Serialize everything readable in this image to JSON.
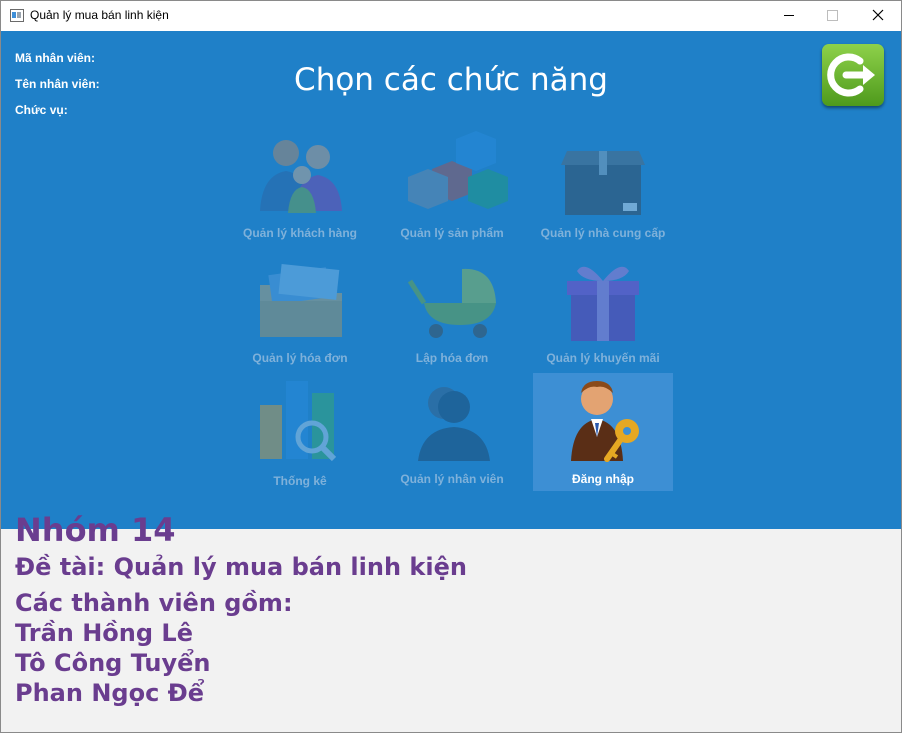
{
  "window": {
    "title": "Quản lý mua bán linh kiện"
  },
  "employee": {
    "id_label": "Mã nhân viên:",
    "name_label": "Tên nhân viên:",
    "role_label": "Chức vụ:"
  },
  "main": {
    "heading": "Chọn các chức năng"
  },
  "functions": [
    {
      "label": "Quản lý khách hàng",
      "icon": "people-group-icon",
      "enabled": false
    },
    {
      "label": "Quản lý sản phẩm",
      "icon": "cubes-icon",
      "enabled": false
    },
    {
      "label": "Quản lý nhà cung cấp",
      "icon": "box-icon",
      "enabled": false
    },
    {
      "label": "Quản lý hóa đơn",
      "icon": "folder-icon",
      "enabled": false
    },
    {
      "label": "Lập hóa đơn",
      "icon": "cart-icon",
      "enabled": false
    },
    {
      "label": "Quản lý khuyến mãi",
      "icon": "gift-icon",
      "enabled": false
    },
    {
      "label": "Thống kê",
      "icon": "chart-icon",
      "enabled": false
    },
    {
      "label": "Quản lý nhân viên",
      "icon": "employee-icon",
      "enabled": false
    },
    {
      "label": "Đăng nhập",
      "icon": "login-user-key-icon",
      "enabled": true
    }
  ],
  "footer": {
    "group": "Nhóm 14",
    "topic": "Đề tài: Quản lý mua bán linh kiện",
    "members_title": "Các thành viên gồm:",
    "members": [
      "Trần Hồng Lê",
      "Tô Công Tuyển",
      "Phan Ngọc Để"
    ]
  },
  "colors": {
    "main_background": "#1f80c8",
    "footer_text": "#6a3d8f",
    "logout_button": "#6cb832"
  }
}
